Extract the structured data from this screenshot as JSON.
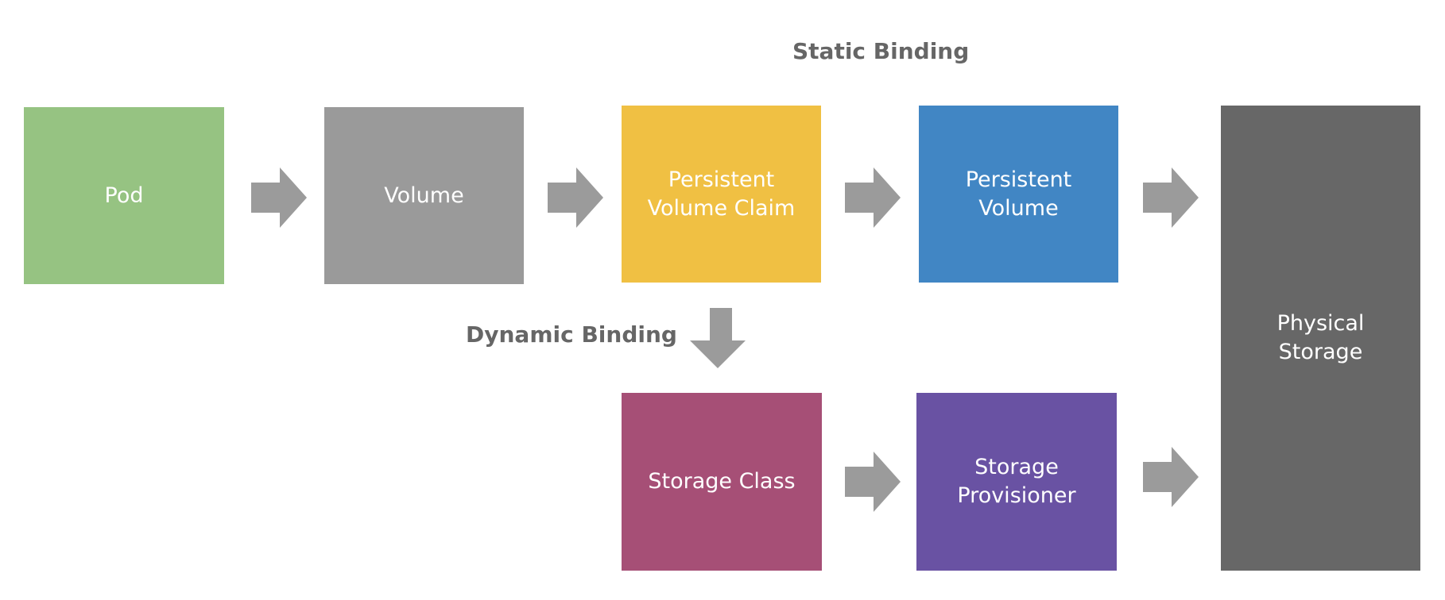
{
  "labels": {
    "static_binding": "Static Binding",
    "dynamic_binding": "Dynamic Binding"
  },
  "nodes": {
    "pod": {
      "label": "Pod",
      "color": "#96c382"
    },
    "volume": {
      "label": "Volume",
      "color": "#9a9a9a"
    },
    "pvc": {
      "label": "Persistent\nVolume Claim",
      "color": "#f0c043"
    },
    "pv": {
      "label": "Persistent\nVolume",
      "color": "#4186c4"
    },
    "physical_storage": {
      "label": "Physical\nStorage",
      "color": "#676767"
    },
    "storage_class": {
      "label": "Storage Class",
      "color": "#a64f76"
    },
    "storage_provisioner": {
      "label": "Storage\nProvisioner",
      "color": "#6952a3"
    }
  },
  "edges": [
    {
      "from": "Pod",
      "to": "Volume"
    },
    {
      "from": "Volume",
      "to": "Persistent Volume Claim"
    },
    {
      "from": "Persistent Volume Claim",
      "to": "Persistent Volume"
    },
    {
      "from": "Persistent Volume",
      "to": "Physical Storage"
    },
    {
      "from": "Persistent Volume Claim",
      "to": "Storage Class"
    },
    {
      "from": "Storage Class",
      "to": "Storage Provisioner"
    },
    {
      "from": "Storage Provisioner",
      "to": "Physical Storage"
    }
  ],
  "arrow_color": "#9b9b9b",
  "label_color": "#666666"
}
